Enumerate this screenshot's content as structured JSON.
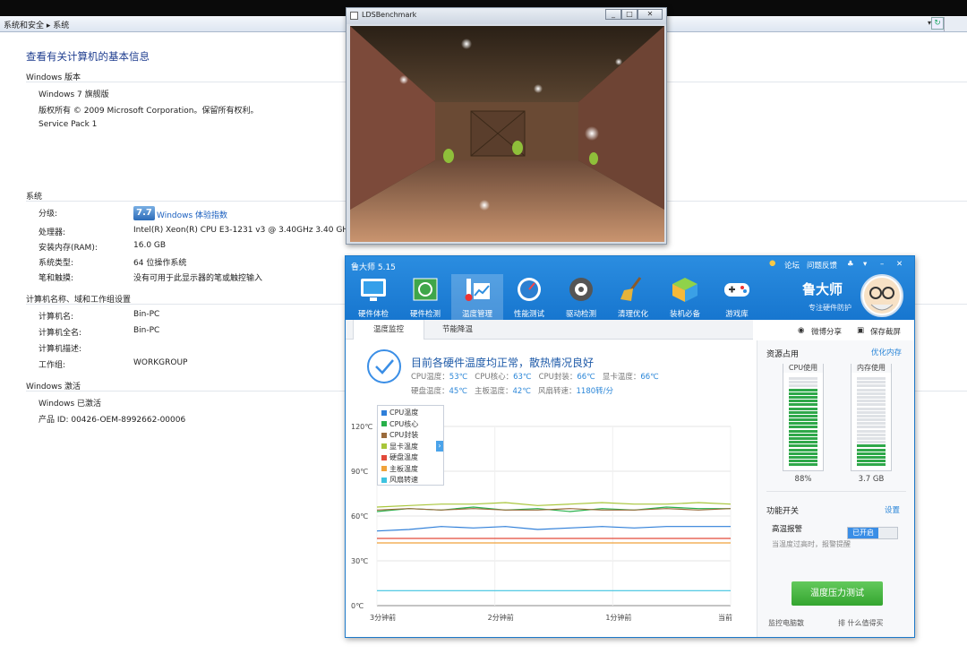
{
  "explorer": {
    "breadcrumb": "系统和安全 ▸ 系统",
    "page_title": "查看有关计算机的基本信息",
    "edition_section": "Windows 版本",
    "edition": "Windows 7 旗舰版",
    "copyright": "版权所有 © 2009 Microsoft Corporation。保留所有权利。",
    "service_pack": "Service Pack 1",
    "system_section": "系统",
    "rating_label": "分级:",
    "rating_score": "7.7",
    "rating_link": "Windows 体验指数",
    "processor_label": "处理器:",
    "processor": "Intel(R) Xeon(R) CPU E3-1231 v3 @ 3.40GHz   3.40 GHz",
    "ram_label": "安装内存(RAM):",
    "ram": "16.0 GB",
    "systype_label": "系统类型:",
    "systype": "64 位操作系统",
    "pen_label": "笔和触摸:",
    "pen": "没有可用于此显示器的笔或触控输入",
    "name_section": "计算机名称、域和工作组设置",
    "cname_label": "计算机名:",
    "cname": "Bin-PC",
    "fullname_label": "计算机全名:",
    "fullname": "Bin-PC",
    "desc_label": "计算机描述:",
    "wg_label": "工作组:",
    "workgroup": "WORKGROUP",
    "act_section": "Windows 激活",
    "activated": "Windows 已激活",
    "product_id": "产品 ID: 00426-OEM-8992662-00006"
  },
  "lds": {
    "title": "LDSBenchmark"
  },
  "ludashi": {
    "title": "鲁大师 5.15",
    "links": [
      "论坛",
      "问题反馈"
    ],
    "nav": [
      "硬件体检",
      "硬件检测",
      "温度管理",
      "性能测试",
      "驱动检测",
      "清理优化",
      "装机必备",
      "游戏库"
    ],
    "brand": "鲁大师",
    "brand_sub": "专注硬件防护",
    "tabs": [
      "温度监控",
      "节能降温"
    ],
    "share": "微博分享",
    "save": "保存截屏",
    "status": "目前各硬件温度均正常，散热情况良好",
    "readings": {
      "cpu_temp_l": "CPU温度：",
      "cpu_temp": "53℃",
      "cpu_core_l": "CPU核心：",
      "cpu_core": "63℃",
      "cpu_pkg_l": "CPU封装：",
      "cpu_pkg": "66℃",
      "gpu_l": "显卡温度：",
      "gpu": "66℃",
      "hdd_l": "硬盘温度：",
      "hdd": "45℃",
      "mb_l": "主板温度：",
      "mb": "42℃",
      "fan_l": "风扇转速：",
      "fan": "1180转/分"
    },
    "resource_title": "资源占用",
    "optimize_mem": "优化内存",
    "cpu_usage_l": "CPU使用",
    "cpu_usage": "88%",
    "mem_usage_l": "内存使用",
    "mem_usage": "3.7 GB",
    "switch_title": "功能开关",
    "settings": "设置",
    "alarm": "高温报警",
    "alarm_state": "已开启",
    "alarm_desc": "当温度过高时，报警提醒",
    "stress_btn": "温度压力测试",
    "footer_l": "监控电脑散",
    "footer_r": "排 什么值得买"
  },
  "chart_data": {
    "type": "line",
    "x": [
      "3分钟前",
      "2分钟前",
      "1分钟前",
      "当前"
    ],
    "yticks": [
      "0℃",
      "30℃",
      "60℃",
      "90℃",
      "120℃"
    ],
    "ylim": [
      0,
      120
    ],
    "legend": [
      {
        "name": "CPU温度",
        "color": "#2f7fd9"
      },
      {
        "name": "CPU核心",
        "color": "#28b04a"
      },
      {
        "name": "CPU封装",
        "color": "#9a6b3c"
      },
      {
        "name": "显卡温度",
        "color": "#a8c63a"
      },
      {
        "name": "硬盘温度",
        "color": "#e24a3b"
      },
      {
        "name": "主板温度",
        "color": "#f0a23a"
      },
      {
        "name": "风扇转速",
        "color": "#3ec3e0"
      }
    ],
    "series": [
      {
        "name": "CPU温度",
        "values": [
          50,
          51,
          53,
          52,
          53,
          51,
          52,
          53,
          52,
          53,
          53,
          53
        ]
      },
      {
        "name": "CPU核心",
        "values": [
          63,
          65,
          64,
          66,
          64,
          65,
          63,
          65,
          64,
          66,
          65,
          65
        ]
      },
      {
        "name": "CPU封装",
        "values": [
          64,
          65,
          64,
          65,
          64,
          64,
          65,
          64,
          64,
          65,
          64,
          65
        ]
      },
      {
        "name": "显卡温度",
        "values": [
          66,
          67,
          68,
          68,
          69,
          67,
          68,
          69,
          68,
          68,
          69,
          68
        ]
      },
      {
        "name": "硬盘温度",
        "values": [
          45,
          45,
          45,
          45,
          45,
          45,
          45,
          45,
          45,
          45,
          45,
          45
        ]
      },
      {
        "name": "主板温度",
        "values": [
          42,
          42,
          42,
          42,
          42,
          42,
          42,
          42,
          42,
          42,
          42,
          42
        ]
      },
      {
        "name": "风扇转速",
        "values": [
          10,
          10,
          10,
          10,
          10,
          10,
          10,
          10,
          10,
          10,
          10,
          10
        ]
      }
    ]
  },
  "resource_meter": {
    "cpu_fraction": 0.88,
    "mem_fraction": 0.23
  }
}
